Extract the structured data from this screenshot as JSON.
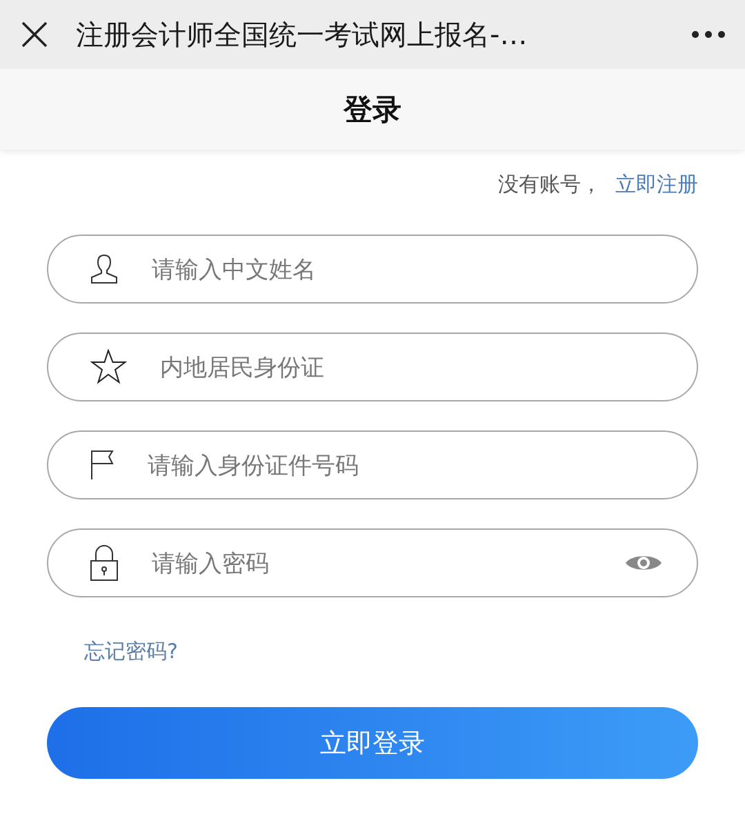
{
  "window": {
    "title": "注册会计师全国统一考试网上报名-…"
  },
  "header": {
    "title": "登录"
  },
  "register_prompt": {
    "text": "没有账号，",
    "link": "立即注册"
  },
  "fields": [
    {
      "placeholder": "请输入中文姓名",
      "reveal_toggle": false
    },
    {
      "placeholder": "内地居民身份证",
      "reveal_toggle": false
    },
    {
      "placeholder": "请输入身份证件号码",
      "reveal_toggle": false
    },
    {
      "placeholder": "请输入密码",
      "reveal_toggle": true
    }
  ],
  "forgot_link": "忘记密码?",
  "submit": "立即登录"
}
